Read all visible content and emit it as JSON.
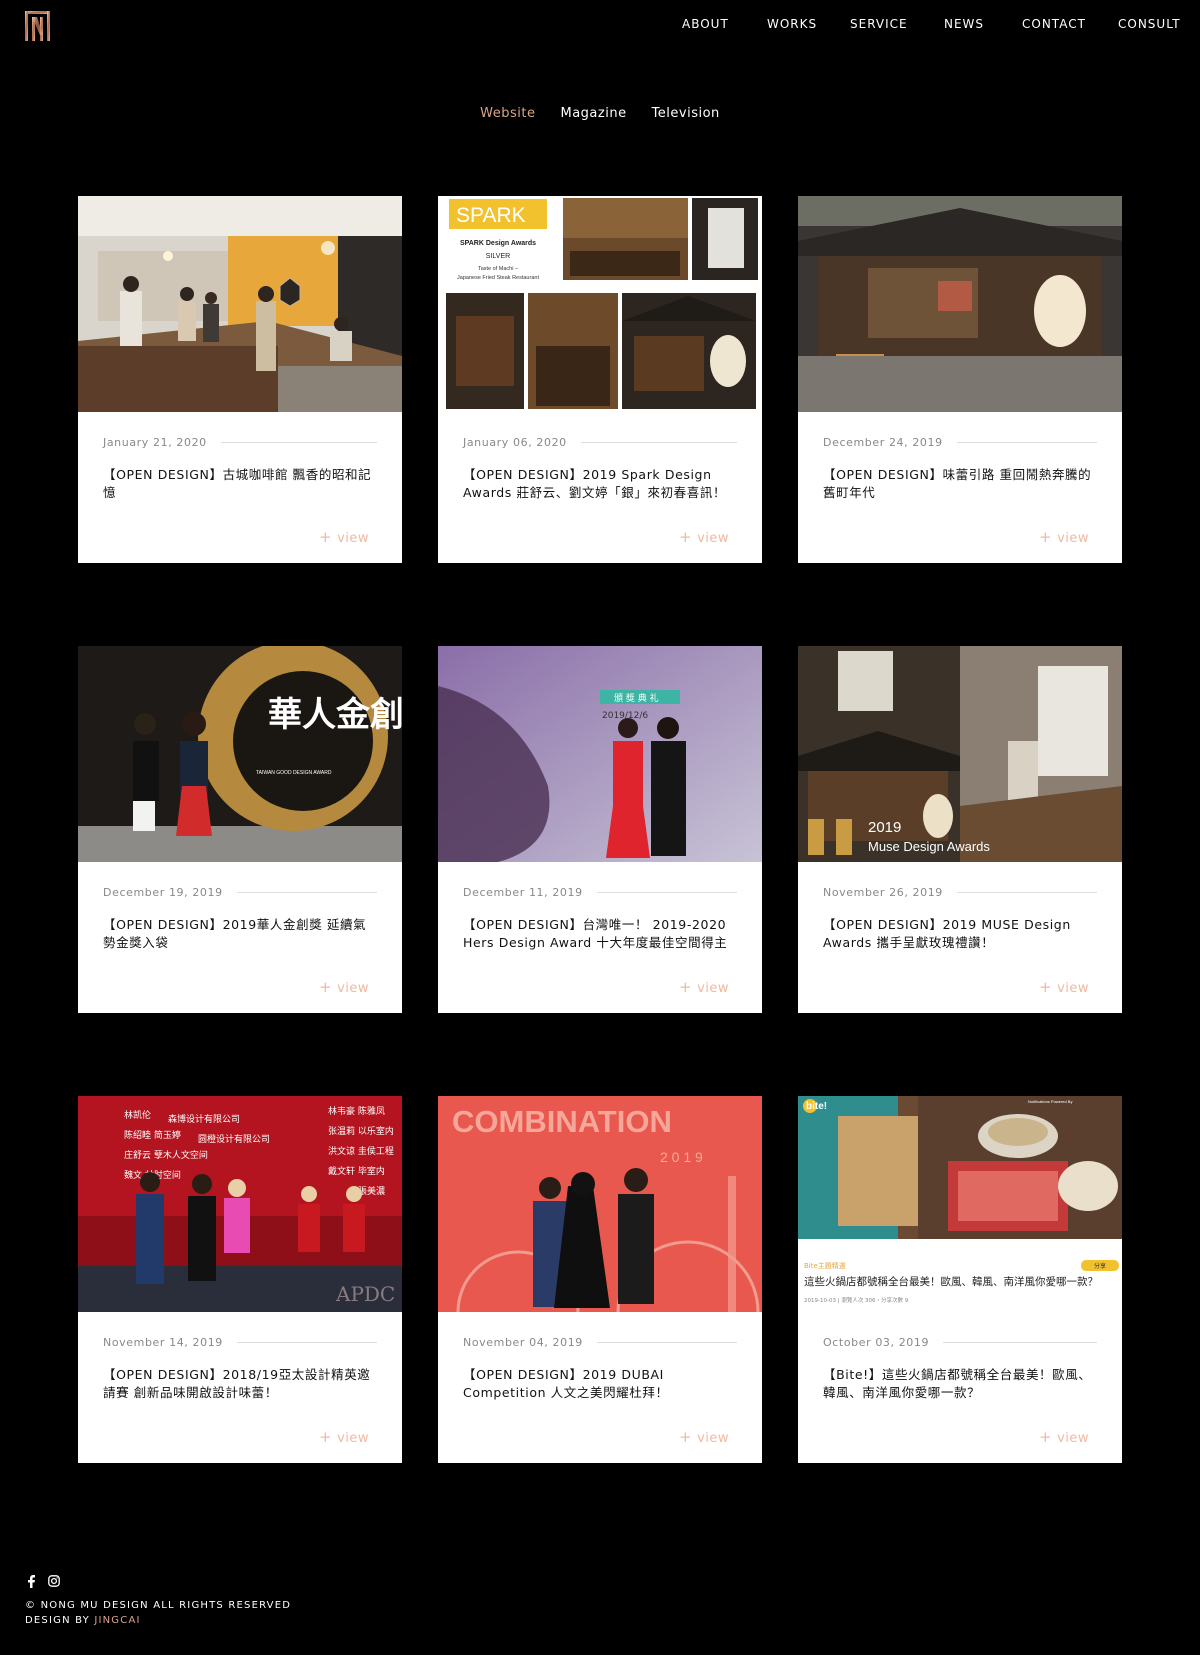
{
  "nav": {
    "items": [
      "ABOUT",
      "WORKS",
      "SERVICE",
      "NEWS",
      "CONTACT",
      "CONSULT"
    ]
  },
  "tabs": [
    {
      "label": "Website",
      "active": true
    },
    {
      "label": "Magazine",
      "active": false
    },
    {
      "label": "Television",
      "active": false
    }
  ],
  "cards": [
    {
      "date": "January 21, 2020",
      "title": "【OPEN DESIGN】古城咖啡館 飄香的昭和記憶",
      "view": "view"
    },
    {
      "date": "January 06, 2020",
      "title": "【OPEN DESIGN】2019 Spark Design Awards 莊舒云、劉文婷「銀」來初春喜訊！",
      "view": "view"
    },
    {
      "date": "December 24, 2019",
      "title": "【OPEN DESIGN】味蕾引路 重回鬧熱奔騰的舊町年代",
      "view": "view"
    },
    {
      "date": "December 19, 2019",
      "title": "【OPEN DESIGN】2019華人金創獎 延續氣勢金獎入袋",
      "view": "view"
    },
    {
      "date": "December 11, 2019",
      "title": "【OPEN DESIGN】台灣唯一！ 2019-2020 Hers Design Award 十大年度最佳空間得主",
      "view": "view"
    },
    {
      "date": "November 26, 2019",
      "title": "【OPEN DESIGN】2019 MUSE Design Awards 攜手呈獻玫瑰禮讚！",
      "view": "view"
    },
    {
      "date": "November 14, 2019",
      "title": "【OPEN DESIGN】2018/19亞太設計精英邀請賽 創新品味開啟設計味蕾！",
      "view": "view"
    },
    {
      "date": "November 04, 2019",
      "title": "【OPEN DESIGN】2019 DUBAI Competition 人文之美閃耀杜拜！",
      "view": "view"
    },
    {
      "date": "October 03, 2019",
      "title": "【Bite!】這些火鍋店都號稱全台最美！歐風、韓風、南洋風你愛哪一款？",
      "view": "view"
    }
  ],
  "image_text": {
    "spark_brand": "SPARK",
    "spark_title": "SPARK Design Awards",
    "spark_level": "SILVER",
    "spark_sub1": "Taste of Machi –",
    "spark_sub2": "Japanese Fried Steak Restaurant",
    "chinese_award": "華人金創獎",
    "award_en": "TAIWAN GOOD DESIGN AWARD",
    "hers_banner": "頒 獎 典 礼",
    "hers_date": "2019/12/6",
    "muse_year": "2019",
    "muse_name": "Muse Design Awards",
    "combination": "COMBINATION",
    "combination_year": "2 0 1 9",
    "bite_logo": "bite!",
    "bite_notice": "Notifications Powered By",
    "bite_tag": "Bite主題精選",
    "bite_share": "分享",
    "bite_headline": "這些火鍋店都號稱全台最美！歐風、韓風、南洋風你愛哪一款？",
    "bite_meta": "2019-10-03  |  瀏覽人次 306・分享次數 9",
    "apdc_list": [
      "林凯伦",
      "森博设计有限公司",
      "陈绍睦 简玉婷",
      "圆橙设计有限公司",
      "庄舒云 孽木人文空间",
      "魏文 甘肘空间"
    ],
    "apdc_list_right": [
      "林韦豪 陈雅凤",
      "张温莉 以乐室内",
      "洪文谅 圭侯工程",
      "戴文轩 毕室内",
      "張美濃"
    ],
    "apdc_mark": "APDC"
  },
  "footer": {
    "copyright": "© NONG MU DESIGN ALL RIGHTS RESERVED",
    "designby_prefix": "DESIGN BY ",
    "designby_credit": "JINGCAI"
  },
  "colors": {
    "background": "#000000",
    "accent": "#d9a58a",
    "view_link": "#f0b9a0"
  }
}
